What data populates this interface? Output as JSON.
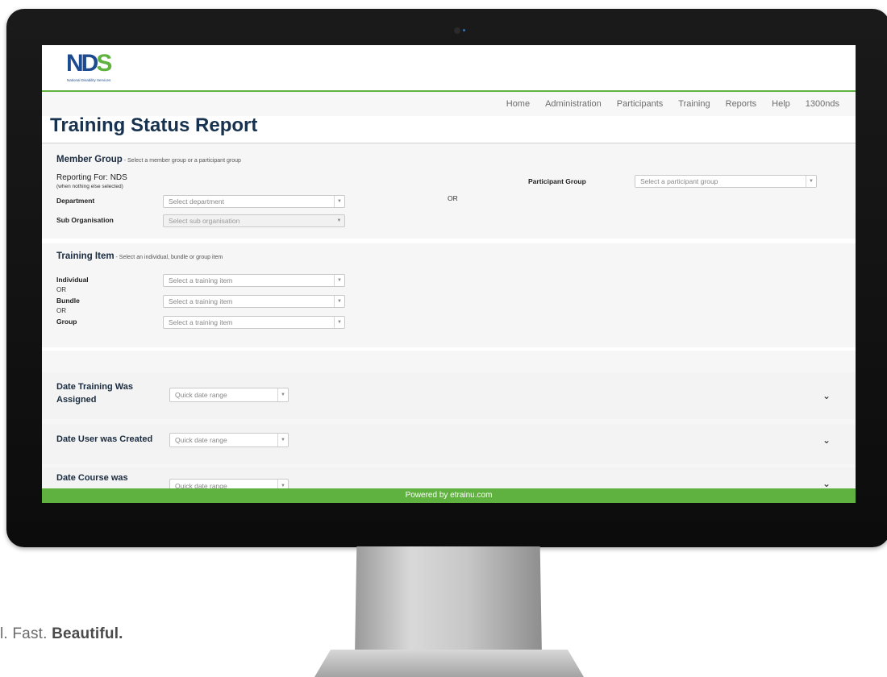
{
  "logo": {
    "text_main": "NDS",
    "text_sub": "National Disability Services"
  },
  "nav": {
    "items": [
      {
        "label": "Home"
      },
      {
        "label": "Administration"
      },
      {
        "label": "Participants"
      },
      {
        "label": "Training"
      },
      {
        "label": "Reports"
      },
      {
        "label": "Help"
      },
      {
        "label": "1300nds"
      }
    ]
  },
  "page": {
    "title": "Training Status Report"
  },
  "member_group": {
    "heading": "Member Group",
    "hint": " - Select a member group or a participant group",
    "reporting_for": "Reporting For: NDS",
    "reporting_note": "(when nothing else selected)",
    "department_label": "Department",
    "department_placeholder": "Select department",
    "sub_org_label": "Sub Organisation",
    "sub_org_placeholder": "Select sub organisation",
    "or_text": "OR",
    "participant_group_label": "Participant Group",
    "participant_group_placeholder": "Select a participant group"
  },
  "training_item": {
    "heading": "Training Item",
    "hint": " - Select an individual, bundle or group item",
    "individual_label": "Individual",
    "bundle_label": "Bundle",
    "group_label": "Group",
    "or_text": "OR",
    "placeholder": "Select a training item"
  },
  "date_filters": [
    {
      "label": "Date Training Was Assigned",
      "placeholder": "Quick date range"
    },
    {
      "label": "Date User was Created",
      "placeholder": "Quick date range"
    },
    {
      "label": "Date Course was",
      "placeholder": "Quick date range"
    }
  ],
  "footer": {
    "text": "Powered by etrainu.com"
  },
  "tagline": {
    "prefix": "l. Fast. ",
    "bold": "Beautiful."
  },
  "colors": {
    "brand_green": "#5fb23f",
    "brand_blue": "#1e4b8f",
    "title_navy": "#17324f"
  }
}
